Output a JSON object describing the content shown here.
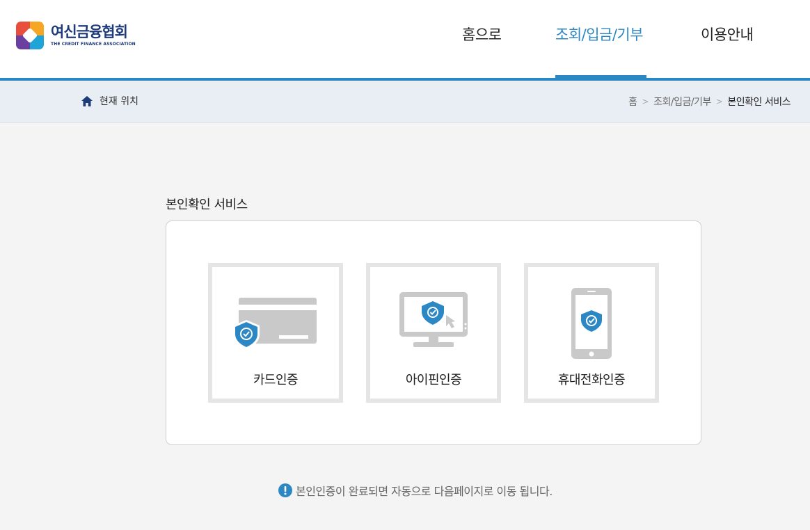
{
  "header": {
    "logo_ko": "여신금융협회",
    "logo_en": "THE CREDIT FINANCE ASSOCIATION",
    "nav": [
      {
        "label": "홈으로"
      },
      {
        "label": "조회/입금/기부",
        "active": true
      },
      {
        "label": "이용안내"
      }
    ]
  },
  "location": {
    "label": "현재 위치",
    "breadcrumb": [
      "홈",
      "조회/입금/기부",
      "본인확인 서비스"
    ]
  },
  "main": {
    "title": "본인확인 서비스",
    "options": [
      {
        "label": "카드인증",
        "icon": "credit-card-shield-icon"
      },
      {
        "label": "아이핀인증",
        "icon": "monitor-shield-icon"
      },
      {
        "label": "휴대전화인증",
        "icon": "phone-shield-icon"
      }
    ],
    "notice": "본인인증이 완료되면 자동으로 다음페이지로 이동 됩니다."
  },
  "colors": {
    "accent": "#2c87c5",
    "icon_gray": "#c9c9c9",
    "card_border": "#e5e5e5",
    "shield": "#2c87c5"
  }
}
